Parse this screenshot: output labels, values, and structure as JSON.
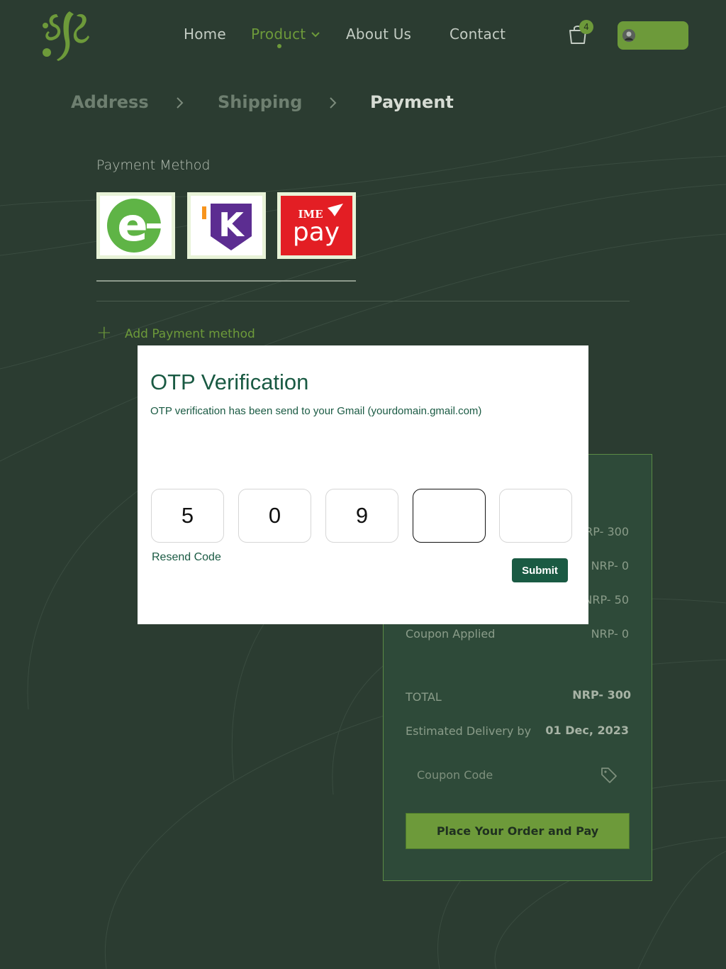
{
  "nav": {
    "home": "Home",
    "product": "Product",
    "about": "About Us",
    "contact": "Contact",
    "cart_count": "4"
  },
  "steps": [
    "Address",
    "Shipping",
    "Payment"
  ],
  "payment": {
    "label": "Payment Method",
    "methods": [
      "esewa",
      "khalti",
      "imepay"
    ],
    "add_label": "Add Payment method"
  },
  "summary": {
    "rows": [
      {
        "label": "",
        "value": "NRP- 300"
      },
      {
        "label": "",
        "value": "NRP- 0"
      },
      {
        "label": "",
        "value": "NRP- 50"
      },
      {
        "label": "Coupon Applied",
        "value": "NRP- 0"
      }
    ],
    "total_label": "TOTAL",
    "total_value": "NRP- 300",
    "delivery_label": "Estimated Delivery by",
    "delivery_value": "01 Dec, 2023",
    "coupon_placeholder": "Coupon Code",
    "place_order": "Place Your Order and Pay"
  },
  "modal": {
    "title": "OTP Verification",
    "subtitle": "OTP verification has been send to your Gmail (yourdomain.gmail.com)",
    "digits": [
      "5",
      "0",
      "9",
      "",
      ""
    ],
    "resend": "Resend Code",
    "submit": "Submit"
  },
  "colors": {
    "background": "#2b3c31",
    "accent": "#6d9a3a",
    "modal_primary": "#1a5a43"
  }
}
